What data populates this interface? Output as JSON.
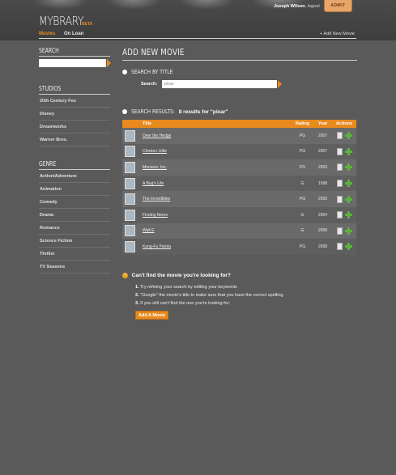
{
  "header": {
    "logo": "MYBRARY",
    "beta": "BETA",
    "username": "Joseph Wilson",
    "logout": "logout",
    "ticket_label": "ADMIT"
  },
  "nav": {
    "tabs": [
      {
        "label": "Movies"
      },
      {
        "label": "On Loan"
      }
    ],
    "add_new": "Add New Movie"
  },
  "sidebar": {
    "search_title": "SEARCH",
    "studios_title": "STUDIOS",
    "studios": [
      "20th Century Fox",
      "Disney",
      "Dreamworks",
      "Warner Bros."
    ],
    "genre_title": "GENRE",
    "genres": [
      "Action/Adventure",
      "Animation",
      "Comedy",
      "Drama",
      "Romance",
      "Science Fiction",
      "Thriller",
      "TV Seasons"
    ]
  },
  "main": {
    "heading": "ADD NEW MOVIE",
    "search_by_title": "SEARCH BY TITLE",
    "search_label": "Search:",
    "search_value": "pixar",
    "results_label": "SEARCH RESULTS:",
    "results_count": "8 results for \"pixar\"",
    "columns": [
      "Title",
      "Rating",
      "Year",
      "Actions"
    ],
    "rows": [
      {
        "title": "Over the Hedge",
        "rating": "PG",
        "year": "2007"
      },
      {
        "title": "Chicken Little",
        "rating": "PG",
        "year": "2007"
      },
      {
        "title": "Monsers, Inc.",
        "rating": "PG",
        "year": "2003"
      },
      {
        "title": "A Bug's Life",
        "rating": "G",
        "year": "1998"
      },
      {
        "title": "The Incredibles",
        "rating": "PG",
        "year": "2005"
      },
      {
        "title": "Finding Nemo",
        "rating": "G",
        "year": "2004"
      },
      {
        "title": "Wall-E",
        "rating": "G",
        "year": "2008"
      },
      {
        "title": "Kung-Fu Panda",
        "rating": "PG",
        "year": "2008"
      }
    ]
  },
  "help": {
    "title": "Can't find the movie you're looking for?",
    "steps": [
      {
        "num": "1.",
        "text": "Try refining your search by editing your keywords"
      },
      {
        "num": "2.",
        "text": "\"Google\" the movie's title to make sure that you have the correct spelling"
      },
      {
        "num": "3.",
        "text": "If you still can't find the one you're looking for:"
      }
    ],
    "button": "Add A Movie"
  },
  "colors": {
    "accent": "#e88a1e",
    "background": "#5a5a5a",
    "plus": "#5ab43a"
  }
}
